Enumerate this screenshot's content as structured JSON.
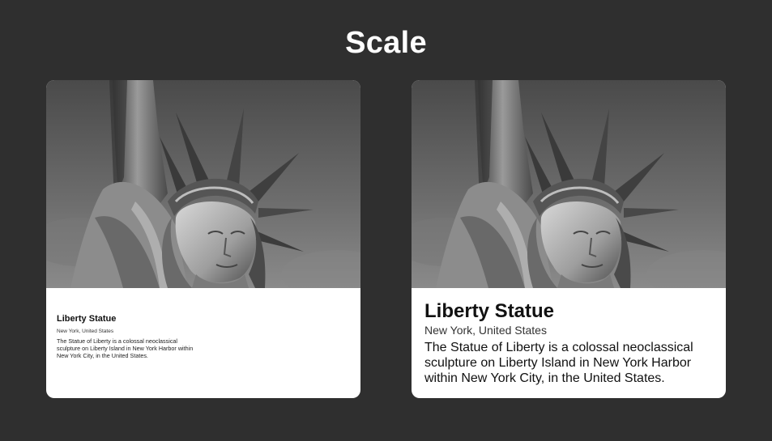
{
  "header": {
    "title": "Scale"
  },
  "cards": [
    {
      "image": "statue-of-liberty-photo",
      "title": "Liberty Statue",
      "subtitle": "New York, United States",
      "description": "The Statue of Liberty is a colossal neoclassical sculpture on Liberty Island in New York Harbor within New York City, in the United States."
    },
    {
      "image": "statue-of-liberty-photo",
      "title": "Liberty Statue",
      "subtitle": "New York, United States",
      "description": "The Statue of Liberty is a colossal neoclassical sculpture on Liberty Island in New York Harbor within New York City, in the United States."
    }
  ],
  "colors": {
    "background": "#2f2f2f",
    "card": "#ffffff",
    "title": "#ffffff"
  }
}
